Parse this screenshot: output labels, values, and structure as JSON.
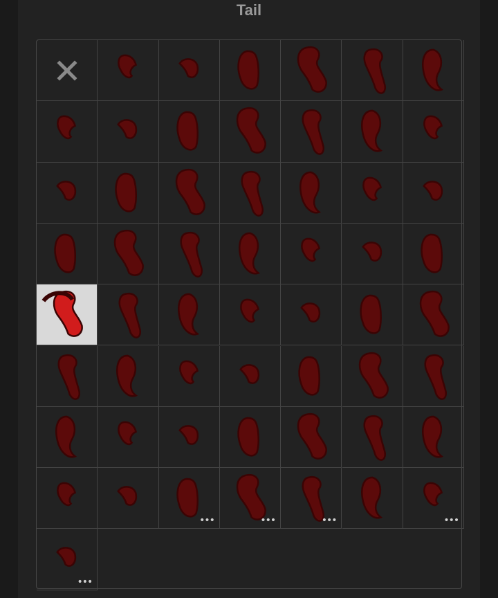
{
  "panel": {
    "title": "Tail"
  },
  "colors": {
    "tail_dark": "#5c0a0a",
    "tail_outline": "#3a0404",
    "tail_bright": "#d11c1c",
    "tail_pink": "#e86a7a",
    "selected_bg": "#d9d9d9",
    "grid_line": "#444444"
  },
  "grid": {
    "columns": 7,
    "items": [
      {
        "name": "none",
        "icon": "close-icon"
      },
      {
        "name": "tail-1"
      },
      {
        "name": "tail-2"
      },
      {
        "name": "tail-3"
      },
      {
        "name": "tail-4"
      },
      {
        "name": "tail-5"
      },
      {
        "name": "tail-6"
      },
      {
        "name": "tail-7"
      },
      {
        "name": "tail-8"
      },
      {
        "name": "tail-9"
      },
      {
        "name": "tail-10"
      },
      {
        "name": "tail-11"
      },
      {
        "name": "tail-12"
      },
      {
        "name": "tail-13"
      },
      {
        "name": "tail-14"
      },
      {
        "name": "tail-15"
      },
      {
        "name": "tail-16"
      },
      {
        "name": "tail-17"
      },
      {
        "name": "tail-18"
      },
      {
        "name": "tail-19"
      },
      {
        "name": "tail-20"
      },
      {
        "name": "tail-21"
      },
      {
        "name": "tail-22"
      },
      {
        "name": "tail-23"
      },
      {
        "name": "tail-24"
      },
      {
        "name": "tail-25"
      },
      {
        "name": "tail-26"
      },
      {
        "name": "tail-27"
      },
      {
        "name": "tail-28",
        "selected": true
      },
      {
        "name": "tail-29"
      },
      {
        "name": "tail-30"
      },
      {
        "name": "tail-31"
      },
      {
        "name": "tail-32"
      },
      {
        "name": "tail-33"
      },
      {
        "name": "tail-34"
      },
      {
        "name": "tail-35"
      },
      {
        "name": "tail-36"
      },
      {
        "name": "tail-37"
      },
      {
        "name": "tail-38"
      },
      {
        "name": "tail-39"
      },
      {
        "name": "tail-40"
      },
      {
        "name": "tail-41"
      },
      {
        "name": "tail-42"
      },
      {
        "name": "tail-43"
      },
      {
        "name": "tail-44"
      },
      {
        "name": "tail-45"
      },
      {
        "name": "tail-46"
      },
      {
        "name": "tail-47"
      },
      {
        "name": "tail-48"
      },
      {
        "name": "tail-49"
      },
      {
        "name": "tail-50"
      },
      {
        "name": "tail-51",
        "more": true
      },
      {
        "name": "tail-52",
        "more": true
      },
      {
        "name": "tail-53",
        "more": true
      },
      {
        "name": "tail-54"
      },
      {
        "name": "tail-55",
        "more": true
      },
      {
        "name": "tail-56",
        "more": true
      }
    ]
  },
  "more_label": "•••"
}
